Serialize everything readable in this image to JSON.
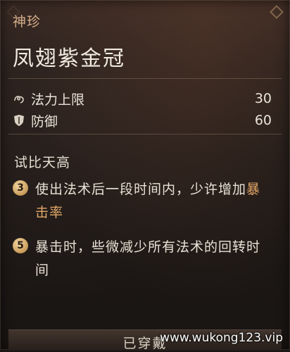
{
  "item": {
    "category": "神珍",
    "name": "凤翅紫金冠"
  },
  "stats": [
    {
      "label": "法力上限",
      "value": "30",
      "icon": "mana-icon"
    },
    {
      "label": "防御",
      "value": "60",
      "icon": "shield-icon"
    }
  ],
  "set_bonus": {
    "name": "试比天高",
    "effects": [
      {
        "pieces": "3",
        "text_before": "使出法术后一段时间内，少许增加",
        "highlight": "暴击率",
        "text_after": ""
      },
      {
        "pieces": "5",
        "text_before": "暴击时，些微减少所有法术的回转时间",
        "highlight": "",
        "text_after": ""
      }
    ]
  },
  "footer": {
    "status": "已穿戴"
  },
  "watermark": "www.wukong123.vip",
  "colors": {
    "category": "#d7b08b",
    "highlight": "#e3a868",
    "badge": "#c89a57"
  }
}
